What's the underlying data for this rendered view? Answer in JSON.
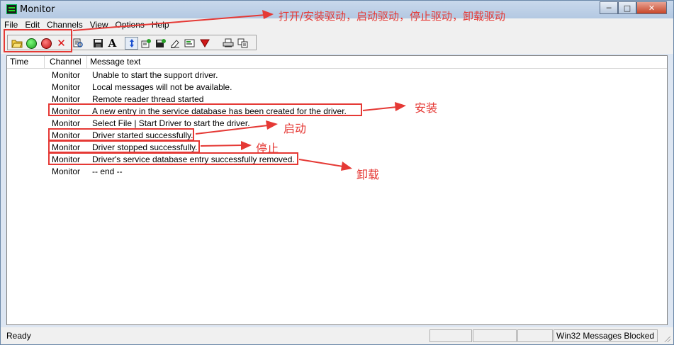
{
  "window": {
    "title": "Monitor",
    "min_symbol": "─",
    "max_symbol": "□",
    "close_symbol": "✕"
  },
  "menu": [
    "File",
    "Edit",
    "Channels",
    "View",
    "Options",
    "Help"
  ],
  "toolbar": {
    "icons": [
      "open-folder-icon",
      "start-driver-icon",
      "stop-driver-icon",
      "remove-driver-icon",
      "find-icon",
      "save-icon",
      "font-icon",
      "scroll-icon",
      "export-icon",
      "save-as-icon",
      "clear-icon",
      "highlight-icon",
      "filter-icon",
      "print-icon",
      "copy-icon"
    ],
    "font_glyph": "A",
    "remove_glyph": "✕"
  },
  "list": {
    "columns": [
      "Time",
      "Channel",
      "Message text"
    ],
    "rows": [
      {
        "channel": "Monitor",
        "message": "Unable to start the support driver."
      },
      {
        "channel": "Monitor",
        "message": "Local messages will not be available."
      },
      {
        "channel": "Monitor",
        "message": "Remote reader thread started"
      },
      {
        "channel": "Monitor",
        "message": "A new entry in the service database has been created for the driver."
      },
      {
        "channel": "Monitor",
        "message": "Select File | Start Driver to start the driver."
      },
      {
        "channel": "Monitor",
        "message": "Driver started successfully."
      },
      {
        "channel": "Monitor",
        "message": "Driver stopped successfully."
      },
      {
        "channel": "Monitor",
        "message": "Driver's service database entry successfully removed."
      },
      {
        "channel": "Monitor",
        "message": "-- end --"
      }
    ]
  },
  "status": {
    "left": "Ready",
    "right": "Win32 Messages Blocked"
  },
  "annotations": {
    "toolbar_note": "打开/安装驱动，启动驱动，停止驱动，卸载驱动",
    "install": "安装",
    "start": "启动",
    "stop": "停止",
    "uninstall": "卸载",
    "color": "#e53935"
  }
}
